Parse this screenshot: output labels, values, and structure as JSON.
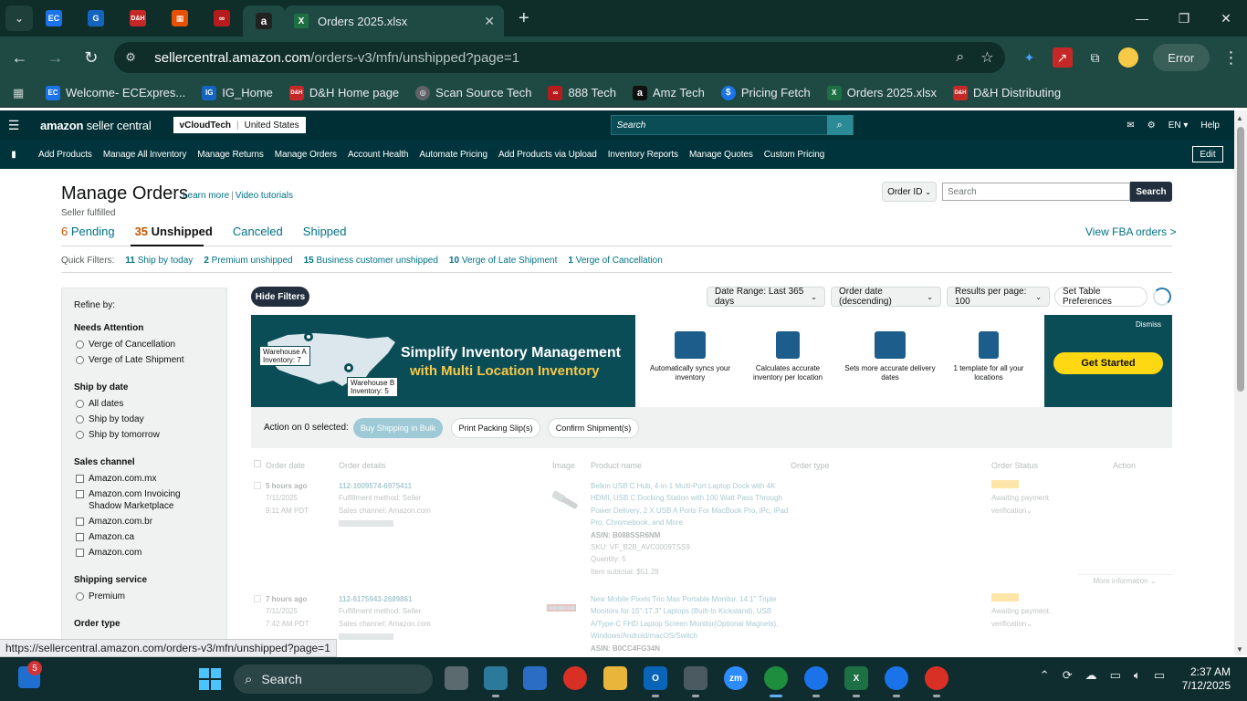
{
  "browser": {
    "active_tab_title": "Orders 2025.xlsx",
    "url_host": "sellercentral.amazon.com",
    "url_path": "/orders-v3/mfn/unshipped?page=1",
    "error_label": "Error",
    "pinned_tabs": [
      {
        "icon": "EC",
        "color": "#1a73e8"
      },
      {
        "icon": "G",
        "color": "#1565c0"
      },
      {
        "icon": "D&H",
        "color": "#c62828"
      },
      {
        "icon": "▦",
        "color": "#e65100"
      },
      {
        "icon": "∞",
        "color": "#b71c1c"
      },
      {
        "icon": "a",
        "color": "#222222"
      }
    ],
    "bookmarks": [
      {
        "label": "Welcome- ECExpres...",
        "icon": "EC",
        "color": "#1a73e8"
      },
      {
        "label": "IG_Home",
        "icon": "IG",
        "color": "#1565c0"
      },
      {
        "label": "D&H Home page",
        "icon": "D&H",
        "color": "#c62828"
      },
      {
        "label": "Scan Source Tech",
        "icon": "◎",
        "color": "#5f6368"
      },
      {
        "label": "888 Tech",
        "icon": "∞",
        "color": "#b71c1c"
      },
      {
        "label": "Amz Tech",
        "icon": "a",
        "color": "#111111"
      },
      {
        "label": "Pricing Fetch",
        "icon": "$",
        "color": "#1a73e8"
      },
      {
        "label": "Orders 2025.xlsx",
        "icon": "X",
        "color": "#1d7044"
      },
      {
        "label": "D&H Distributing",
        "icon": "D&H",
        "color": "#c62828"
      }
    ],
    "status_url": "https://sellercentral.amazon.com/orders-v3/mfn/unshipped?page=1"
  },
  "sc": {
    "logo_brand": "amazon",
    "logo_suffix": "seller central",
    "account": "vCloudTech",
    "region": "United States",
    "search_placeholder": "Search",
    "lang": "EN",
    "help": "Help",
    "nav": [
      "Add Products",
      "Manage All Inventory",
      "Manage Returns",
      "Manage Orders",
      "Account Health",
      "Automate Pricing",
      "Add Products via Upload",
      "Inventory Reports",
      "Manage Quotes",
      "Custom Pricing"
    ],
    "edit": "Edit"
  },
  "page": {
    "title": "Manage Orders",
    "learn_more": "Learn more",
    "video_tutorials": "Video tutorials",
    "subtitle": "Seller fulfilled",
    "orderid_select": "Order ID",
    "search_placeholder": "Search",
    "search_button": "Search",
    "fba_link": "View FBA orders >",
    "status_tabs": [
      {
        "count": "6",
        "label": "Pending"
      },
      {
        "count": "35",
        "label": "Unshipped"
      },
      {
        "count": "",
        "label": "Canceled"
      },
      {
        "count": "",
        "label": "Shipped"
      }
    ],
    "quick_filters_label": "Quick Filters:",
    "quick_filters": [
      {
        "count": "11",
        "label": "Ship by today"
      },
      {
        "count": "2",
        "label": "Premium unshipped"
      },
      {
        "count": "15",
        "label": "Business customer unshipped"
      },
      {
        "count": "10",
        "label": "Verge of Late Shipment"
      },
      {
        "count": "1",
        "label": "Verge of Cancellation"
      }
    ]
  },
  "sidebar": {
    "refine": "Refine by:",
    "needs_attention": "Needs Attention",
    "needs_attention_opts": [
      "Verge of Cancellation",
      "Verge of Late Shipment"
    ],
    "ship_by_date": "Ship by date",
    "ship_by_opts": [
      "All dates",
      "Ship by today",
      "Ship by tomorrow"
    ],
    "sales_channel": "Sales channel",
    "sales_channel_opts": [
      "Amazon.com.mx",
      "Amazon.com Invoicing Shadow Marketplace",
      "Amazon.com.br",
      "Amazon.ca",
      "Amazon.com"
    ],
    "shipping_service": "Shipping service",
    "shipping_opts": [
      "Premium"
    ],
    "order_type": "Order type"
  },
  "controls": {
    "hide_filters": "Hide Filters",
    "date_range": "Date Range: Last 365 days",
    "sort": "Order date (descending)",
    "per_page": "Results per page: 100",
    "table_prefs": "Set Table Preferences"
  },
  "banner": {
    "headline1": "Simplify Inventory Management",
    "headline2": "with Multi Location Inventory",
    "warehouse_a_name": "Warehouse A",
    "warehouse_a_inv": "Inventory: 7",
    "warehouse_b_name": "Warehouse B",
    "warehouse_b_inv": "Inventory: 5",
    "features": [
      "Automatically syncs your inventory",
      "Calculates accurate inventory per location",
      "Sets more accurate delivery dates",
      "1 template for all your locations"
    ],
    "dismiss": "Dismiss",
    "cta": "Get Started"
  },
  "actions": {
    "label": "Action on 0 selected:",
    "buy_shipping": "Buy Shipping in Bulk",
    "print_slips": "Print Packing Slip(s)",
    "confirm": "Confirm Shipment(s)"
  },
  "table": {
    "headers": [
      "Order date",
      "Order details",
      "Image",
      "Product name",
      "Order type",
      "Order Status",
      "Action"
    ],
    "rows": [
      {
        "age": "5 hours ago",
        "date": "7/11/2025",
        "time": "9:11 AM PDT",
        "order_id": "112-1009574-6975411",
        "fulfillment": "Fulfillment method: Seller",
        "channel": "Sales channel: Amazon.com",
        "product_lines": [
          "Belkin USB C Hub, 4-in-1 Multi-Port Laptop Dock with 4K",
          "HDMI, USB C Docking Station with 100 Watt Pass Through",
          "Power Delivery, 2 X USB A Ports For MacBook Pro, iPc, iPad",
          "Pro, Chromebook, and More"
        ],
        "asin": "ASIN: B088SSR6NM",
        "sku": "SKU: VF_B2B_AVC0009TSS9",
        "qty": "Quantity: 5",
        "subtotal": "Item subtotal: $51.28",
        "status_line1": "Awaiting payment",
        "status_line2": "verification",
        "more": "More information"
      },
      {
        "age": "7 hours ago",
        "date": "7/11/2025",
        "time": "7:42 AM PDT",
        "order_id": "112-6175943-2689861",
        "fulfillment": "Fulfillment method: Seller",
        "channel": "Sales channel: Amazon.com",
        "product_lines": [
          "New Mobile Pixels Trio Max Portable Monitor, 14.1\" Triple",
          "Monitors for 15\"-17.3\" Laptops (Built-In Kickstand), USB",
          "A/Type-C FHD Laptop Screen Monitor(Optional Magnets),",
          "Windows/Android/macOS/Switch"
        ],
        "asin": "ASIN: B0CC4FG34N",
        "status_line1": "Awaiting payment",
        "status_line2": "verification"
      }
    ]
  },
  "taskbar": {
    "search": "Search",
    "notif_count": "5",
    "time": "2:37 AM",
    "date": "7/12/2025"
  }
}
